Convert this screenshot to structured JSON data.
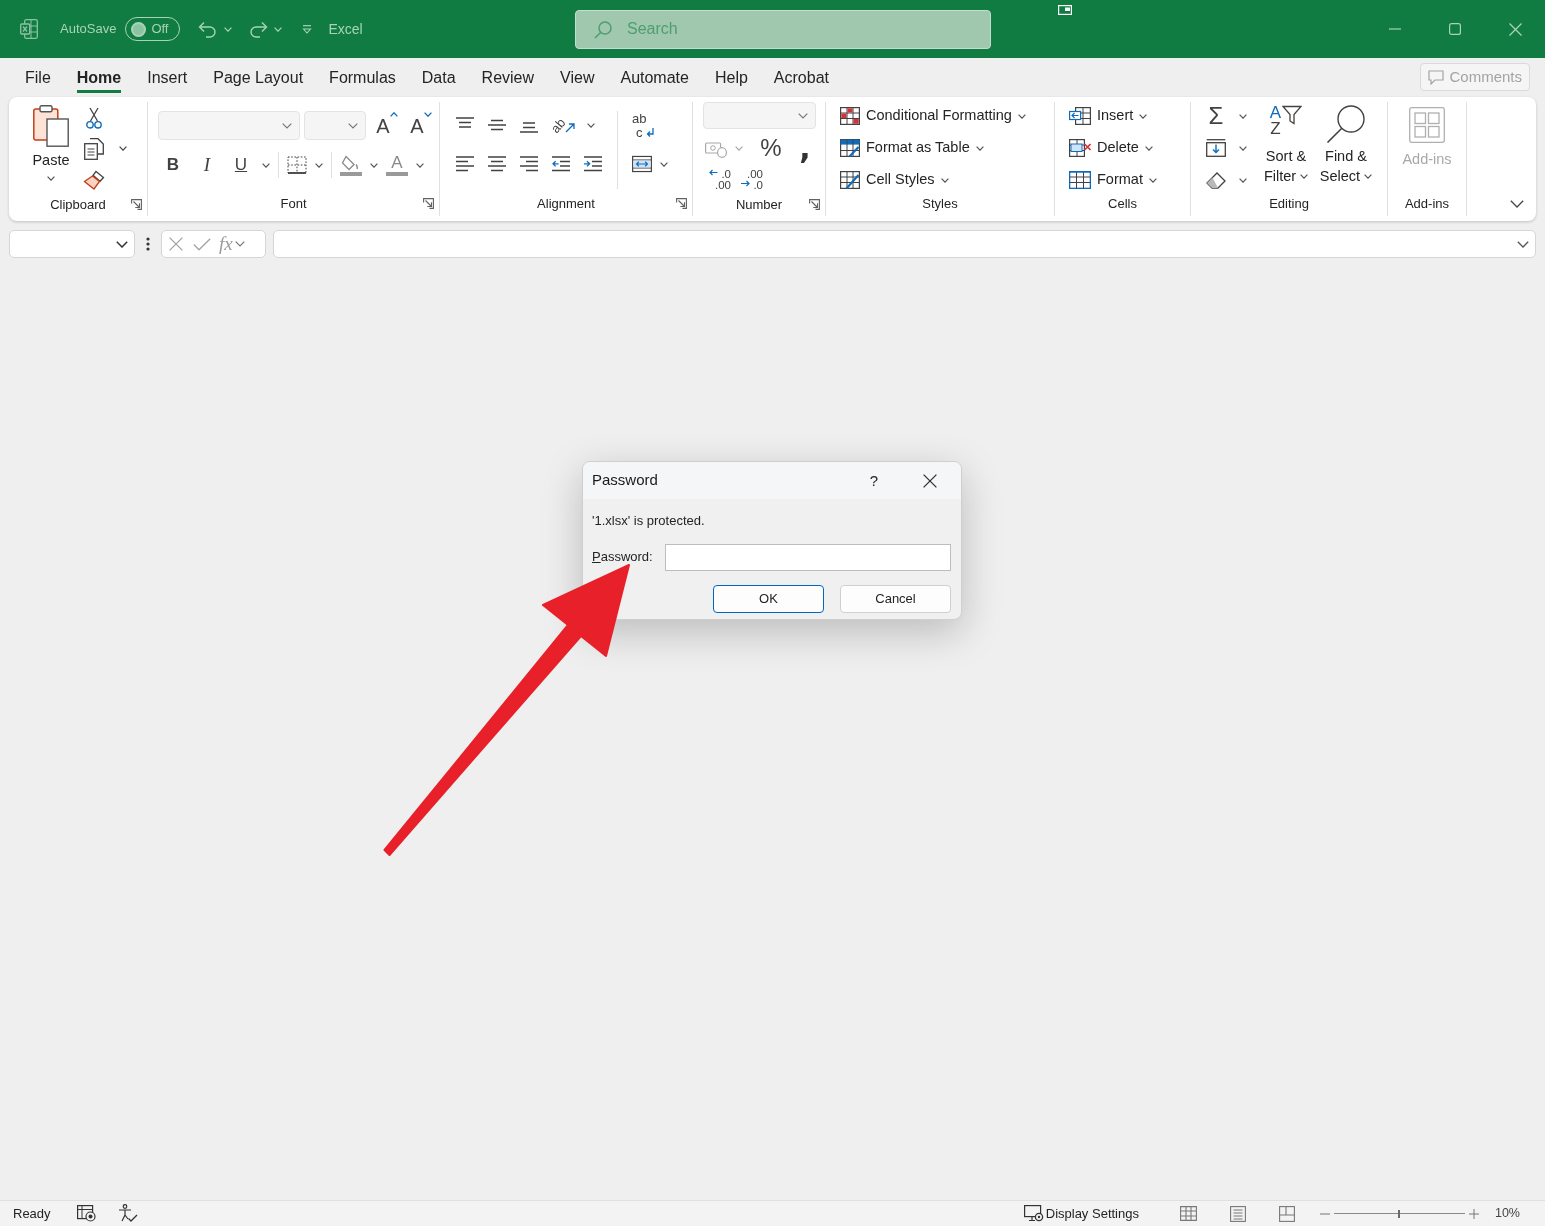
{
  "title_bar": {
    "autosave": {
      "label": "AutoSave",
      "toggle_label": "Off",
      "on": false
    },
    "app_name": "Excel",
    "search": {
      "placeholder": "Search"
    }
  },
  "menu_tabs": [
    {
      "label": "File",
      "selected": false
    },
    {
      "label": "Home",
      "selected": true
    },
    {
      "label": "Insert",
      "selected": false
    },
    {
      "label": "Page Layout",
      "selected": false
    },
    {
      "label": "Formulas",
      "selected": false
    },
    {
      "label": "Data",
      "selected": false
    },
    {
      "label": "Review",
      "selected": false
    },
    {
      "label": "View",
      "selected": false
    },
    {
      "label": "Automate",
      "selected": false
    },
    {
      "label": "Help",
      "selected": false
    },
    {
      "label": "Acrobat",
      "selected": false
    }
  ],
  "comments_button": {
    "label": "Comments",
    "disabled": true
  },
  "ribbon": {
    "groups": [
      {
        "kind": "clipboard",
        "label": "Clipboard",
        "launcher": true,
        "paste_label": "Paste"
      },
      {
        "kind": "font",
        "label": "Font",
        "launcher": true,
        "grow_font_glyph": "A",
        "shrink_font_glyph": "A",
        "bold_glyph": "B",
        "italic_glyph": "I",
        "underline_glyph": "U",
        "font_color_glyph": "A"
      },
      {
        "kind": "alignment",
        "label": "Alignment",
        "launcher": true,
        "orientation_glyph": "ab",
        "wrap_text_glyphs": [
          "ab",
          "c"
        ]
      },
      {
        "kind": "number",
        "label": "Number",
        "launcher": true,
        "percent_glyph": "%",
        "comma_glyph": ",",
        "increase_decimal_glyphs": [
          ".0",
          ".00"
        ],
        "decrease_decimal_glyphs": [
          ".00",
          ".0"
        ]
      },
      {
        "kind": "styles",
        "label": "Styles",
        "buttons": [
          {
            "label": "Conditional Formatting"
          },
          {
            "label": "Format as Table"
          },
          {
            "label": "Cell Styles"
          }
        ]
      },
      {
        "kind": "cells",
        "label": "Cells",
        "buttons": [
          {
            "label": "Insert"
          },
          {
            "label": "Delete"
          },
          {
            "label": "Format"
          }
        ]
      },
      {
        "kind": "editing",
        "label": "Editing",
        "autosum_glyph": "Σ",
        "sort_glyphs": [
          "A",
          "Z"
        ],
        "buttons": [
          {
            "label": "Sort & Filter"
          },
          {
            "label": "Find & Select"
          }
        ]
      },
      {
        "kind": "addins",
        "label": "Add-ins",
        "button": {
          "label": "Add-ins",
          "disabled": true
        }
      }
    ]
  },
  "formula_bar": {
    "function_glyph": "fx"
  },
  "dialog": {
    "title": "Password",
    "help_glyph": "?",
    "message": "'1.xlsx' is protected.",
    "field_label": "Password:",
    "access_key_underlined": true,
    "buttons": [
      {
        "label": "OK",
        "default": true
      },
      {
        "label": "Cancel",
        "default": false
      }
    ]
  },
  "annotation": {
    "kind": "arrow"
  },
  "status_bar": {
    "status": "Ready",
    "display_settings": "Display Settings",
    "zoom": {
      "level": 0.5,
      "reading": "10%"
    }
  }
}
